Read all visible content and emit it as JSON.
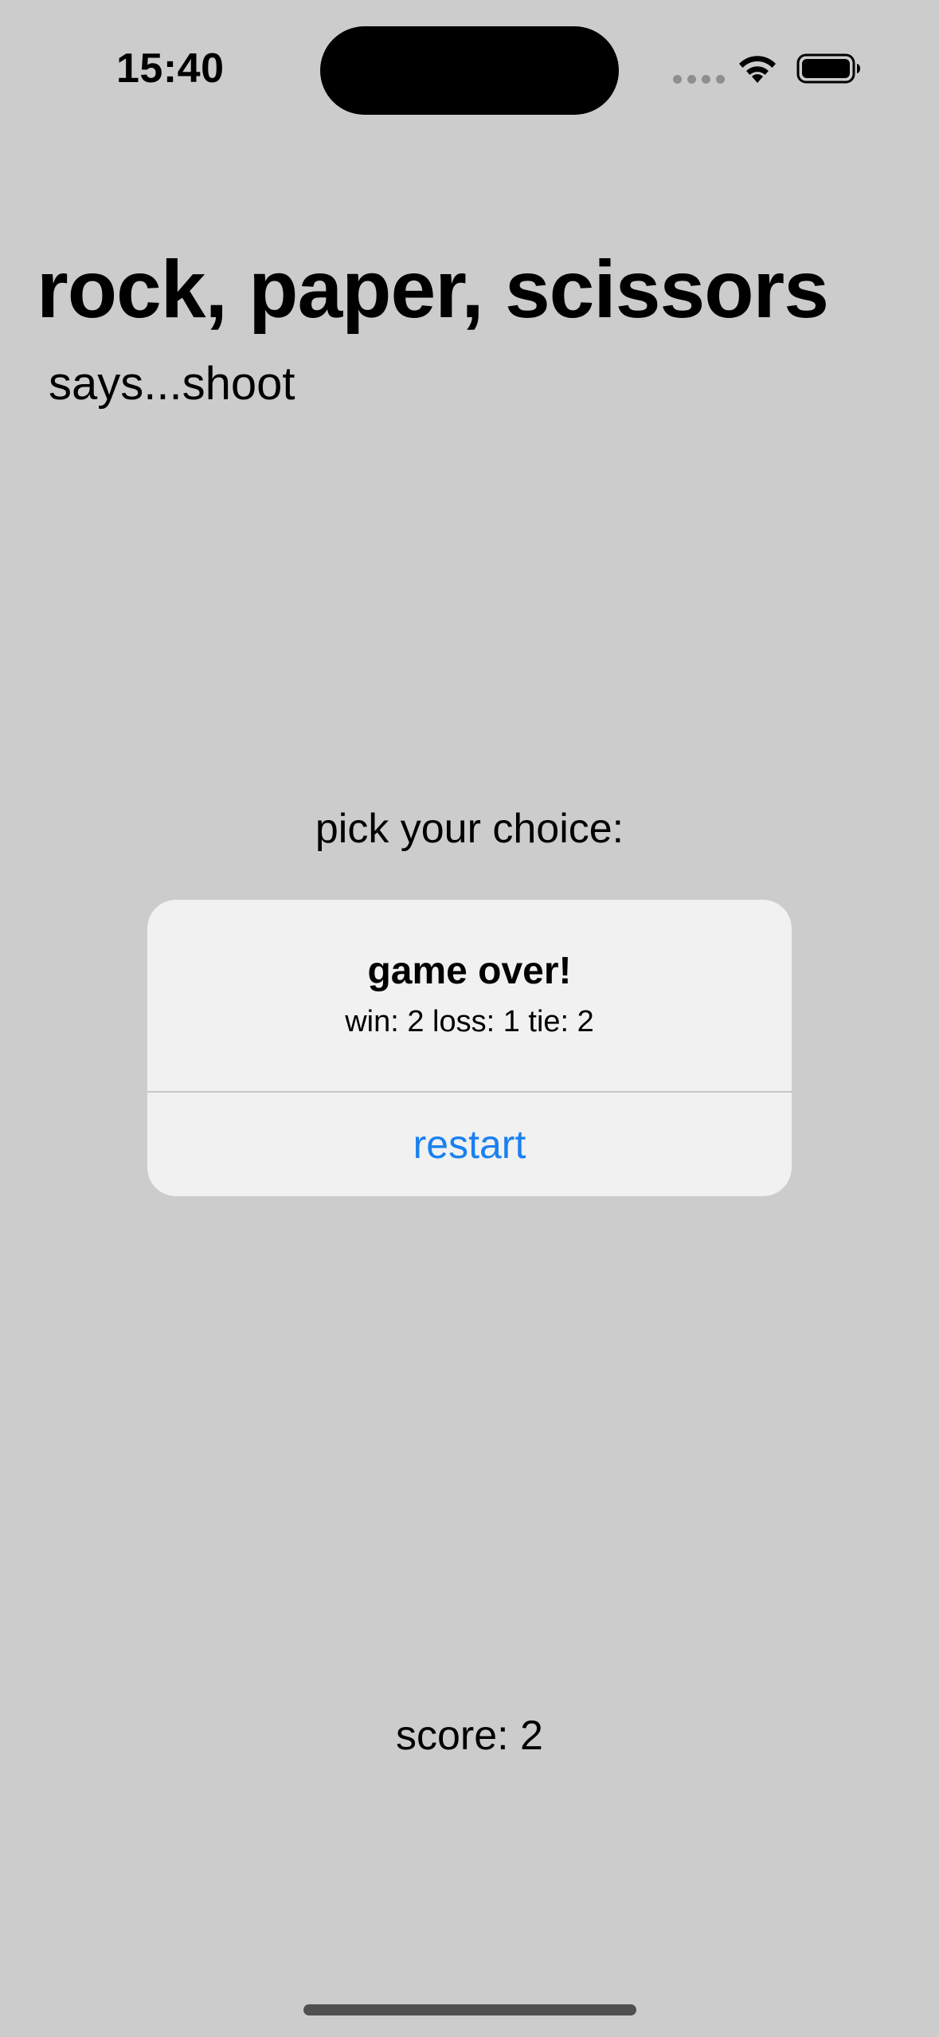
{
  "status_bar": {
    "time": "15:40",
    "icons": [
      "cellular-signal-icon",
      "wifi-icon",
      "battery-icon"
    ]
  },
  "header": {
    "title": "rock, paper, scissors",
    "subtitle": "says...shoot"
  },
  "game": {
    "prompt": "pick your choice:",
    "score_label": "score: 2"
  },
  "alert": {
    "title": "game over!",
    "message": "win: 2 loss: 1 tie: 2",
    "button_label": "restart"
  },
  "colors": {
    "background": "#cccccc",
    "alert_background": "#f0f1f0",
    "accent": "#1a80f0"
  }
}
